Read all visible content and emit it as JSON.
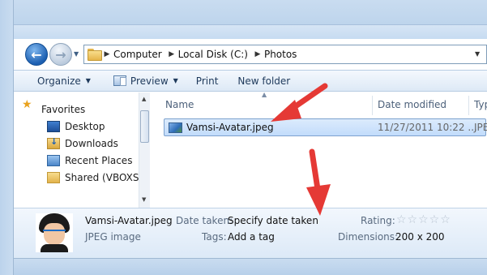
{
  "navigation": {
    "breadcrumb": [
      "Computer",
      "Local Disk (C:)",
      "Photos"
    ]
  },
  "toolbar": {
    "organize_label": "Organize",
    "preview_label": "Preview",
    "print_label": "Print",
    "new_folder_label": "New folder"
  },
  "sidebar": {
    "favorites_label": "Favorites",
    "items": [
      {
        "label": "Desktop",
        "icon": "desktop-icon"
      },
      {
        "label": "Downloads",
        "icon": "downloads-icon"
      },
      {
        "label": "Recent Places",
        "icon": "recent-places-icon"
      },
      {
        "label": "Shared (VBOXSVR",
        "icon": "shared-folder-icon"
      }
    ]
  },
  "file_list": {
    "columns": [
      "Name",
      "Date modified",
      "Typ"
    ],
    "rows": [
      {
        "name": "Vamsi-Avatar.jpeg",
        "date_modified": "11/27/2011 10:22 ...",
        "type": "JPEG"
      }
    ]
  },
  "details": {
    "file_name": "Vamsi-Avatar.jpeg",
    "file_type": "JPEG image",
    "date_taken_label": "Date taken:",
    "date_taken_value": "Specify date taken",
    "tags_label": "Tags:",
    "tags_value": "Add a tag",
    "rating_label": "Rating:",
    "rating_stars": "☆☆☆☆☆",
    "rating_value": 0,
    "dimensions_label": "Dimensions:",
    "dimensions_value": "200 x 200"
  },
  "colors": {
    "annotation_arrow": "#e53935",
    "selection": "#c2dcfb"
  }
}
